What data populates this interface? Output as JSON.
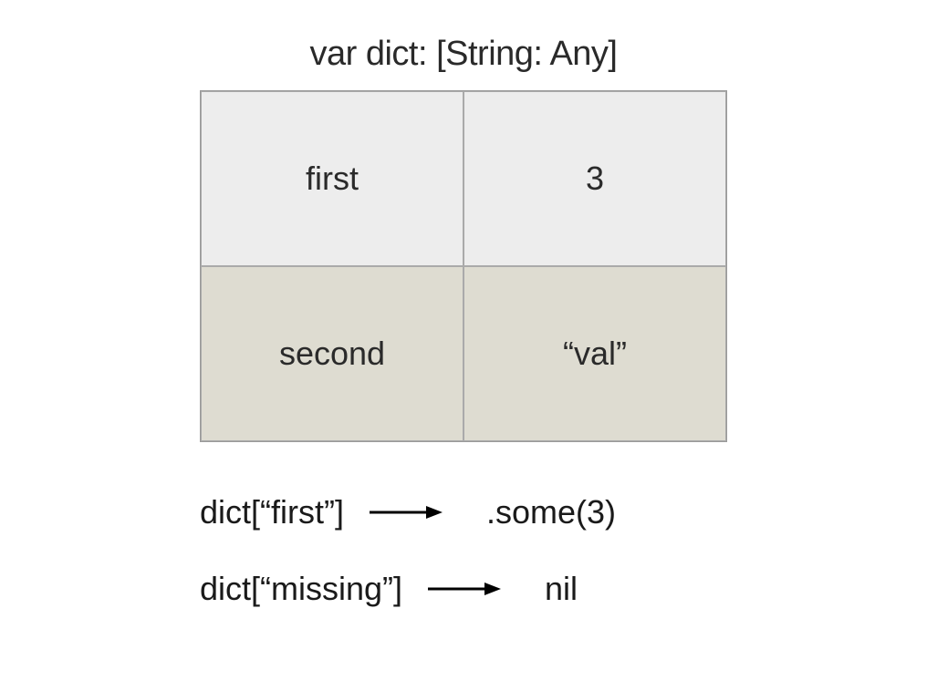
{
  "title": "var dict: [String: Any]",
  "table": {
    "rows": [
      {
        "key": "first",
        "value": "3"
      },
      {
        "key": "second",
        "value": "“val”"
      }
    ]
  },
  "lookups": [
    {
      "expr": "dict[“first”]",
      "result": ".some(3)"
    },
    {
      "expr": "dict[“missing”]",
      "result": "nil"
    }
  ]
}
